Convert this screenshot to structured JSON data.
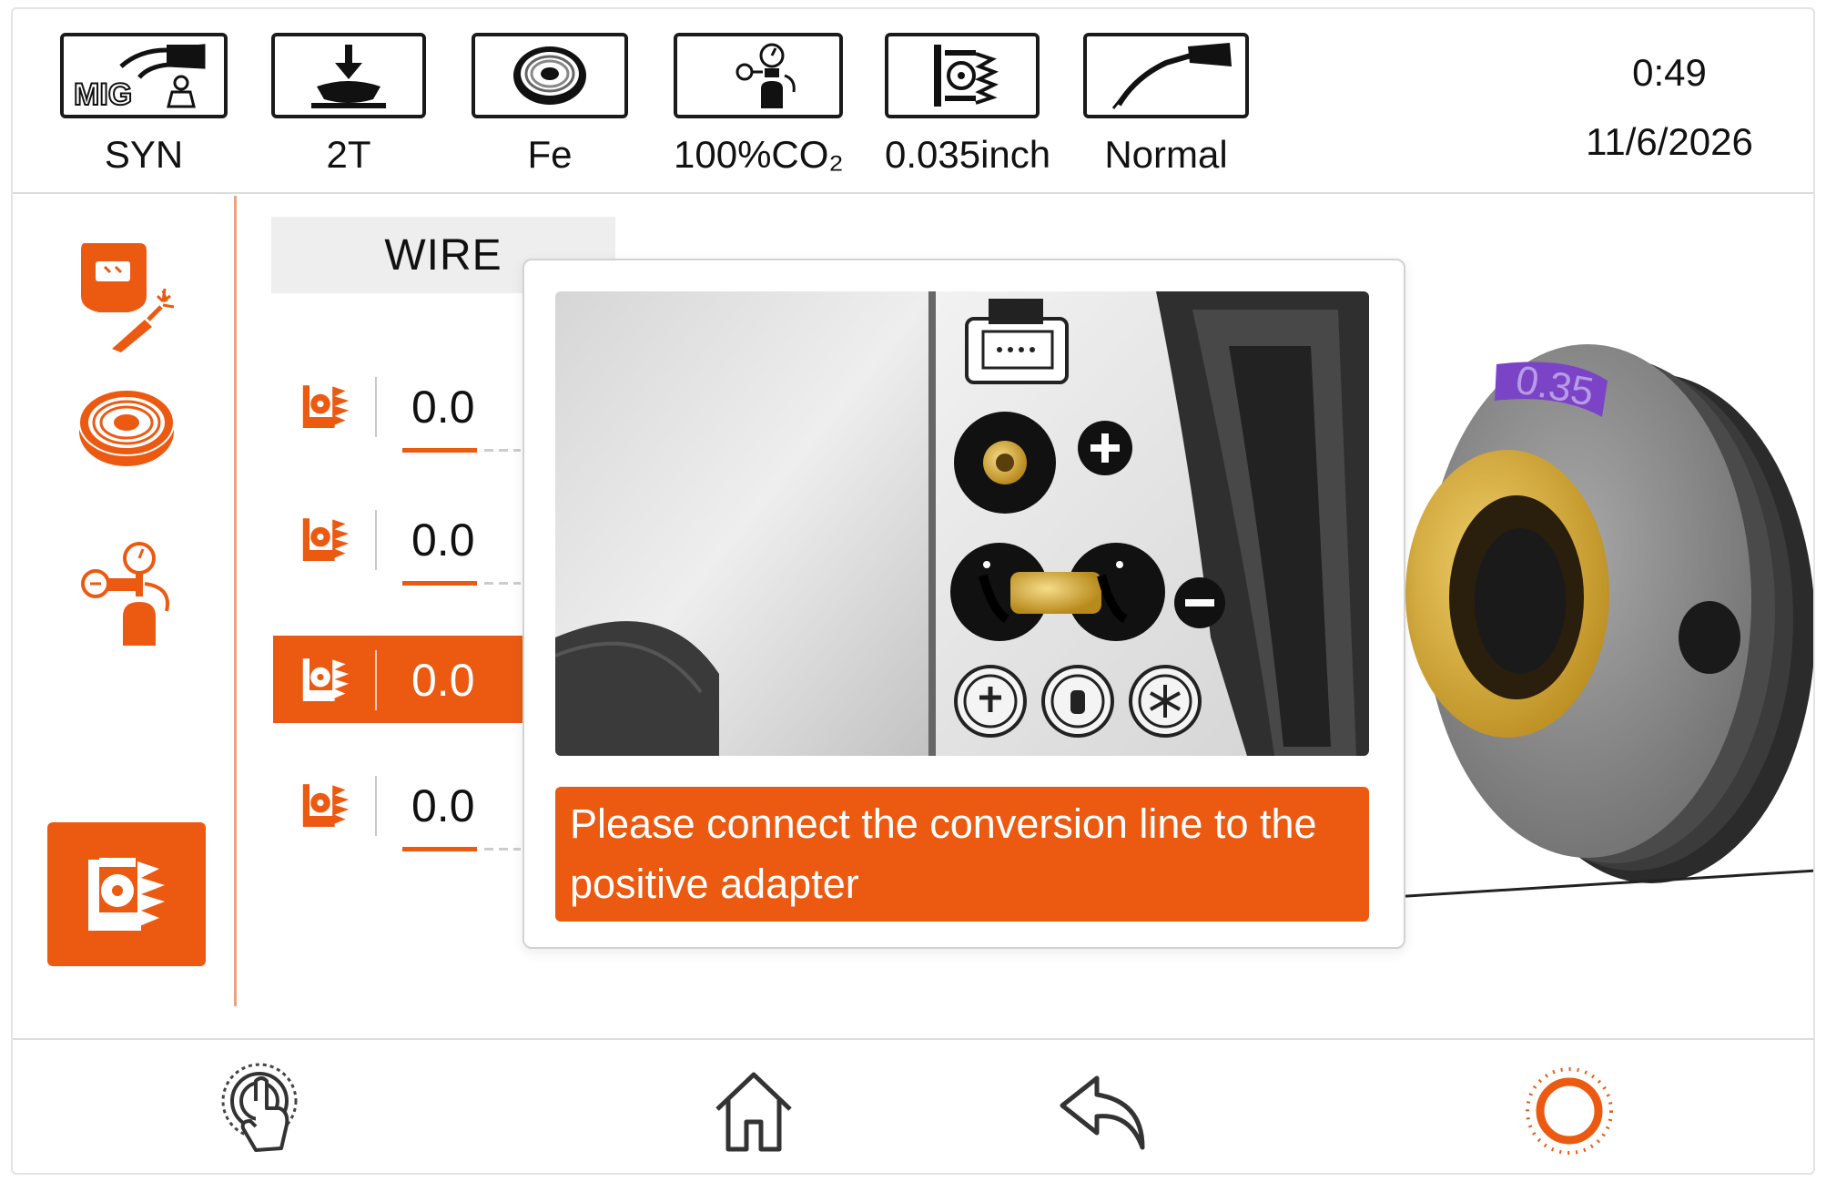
{
  "topbar": {
    "modes": [
      {
        "icon": "mig-torch-icon",
        "icon_text": "MIG",
        "label": "SYN"
      },
      {
        "icon": "trigger-2t-icon",
        "label": "2T"
      },
      {
        "icon": "wire-spool-icon",
        "label": "Fe"
      },
      {
        "icon": "gas-cylinder-icon",
        "label": "100%CO₂"
      },
      {
        "icon": "wire-diameter-icon",
        "label": "0.035inch"
      },
      {
        "icon": "welding-torch-icon",
        "label": "Normal"
      }
    ],
    "time": "0:49",
    "date": "11/6/2026"
  },
  "sidebar": {
    "items": [
      {
        "icon": "welder-helmet-icon",
        "active": false
      },
      {
        "icon": "wire-spool-icon",
        "active": false
      },
      {
        "icon": "gas-regulator-icon",
        "active": false
      },
      {
        "icon": "wire-feed-roller-icon",
        "active": true
      }
    ]
  },
  "wire_panel": {
    "header": "WIRE",
    "params": [
      {
        "icon": "wire-feed-roller-icon",
        "value": "0.0",
        "selected": false
      },
      {
        "icon": "wire-feed-roller-icon",
        "value": "0.0",
        "selected": false
      },
      {
        "icon": "wire-feed-roller-icon",
        "value": "0.0",
        "selected": true
      },
      {
        "icon": "wire-feed-roller-icon",
        "value": "0.0",
        "selected": false
      }
    ]
  },
  "background": {
    "spool_label": "0.35"
  },
  "modal": {
    "image": "polarity-terminal-diagram",
    "message": "Please connect the conversion line to the positive adapter"
  },
  "bottombar": {
    "items": [
      {
        "icon": "touch-icon"
      },
      {
        "icon": "home-icon"
      },
      {
        "icon": "back-icon"
      },
      {
        "icon": "power-ring-icon"
      }
    ]
  },
  "colors": {
    "accent": "#ec5a12",
    "text": "#111111",
    "border": "#dcdcdc"
  }
}
